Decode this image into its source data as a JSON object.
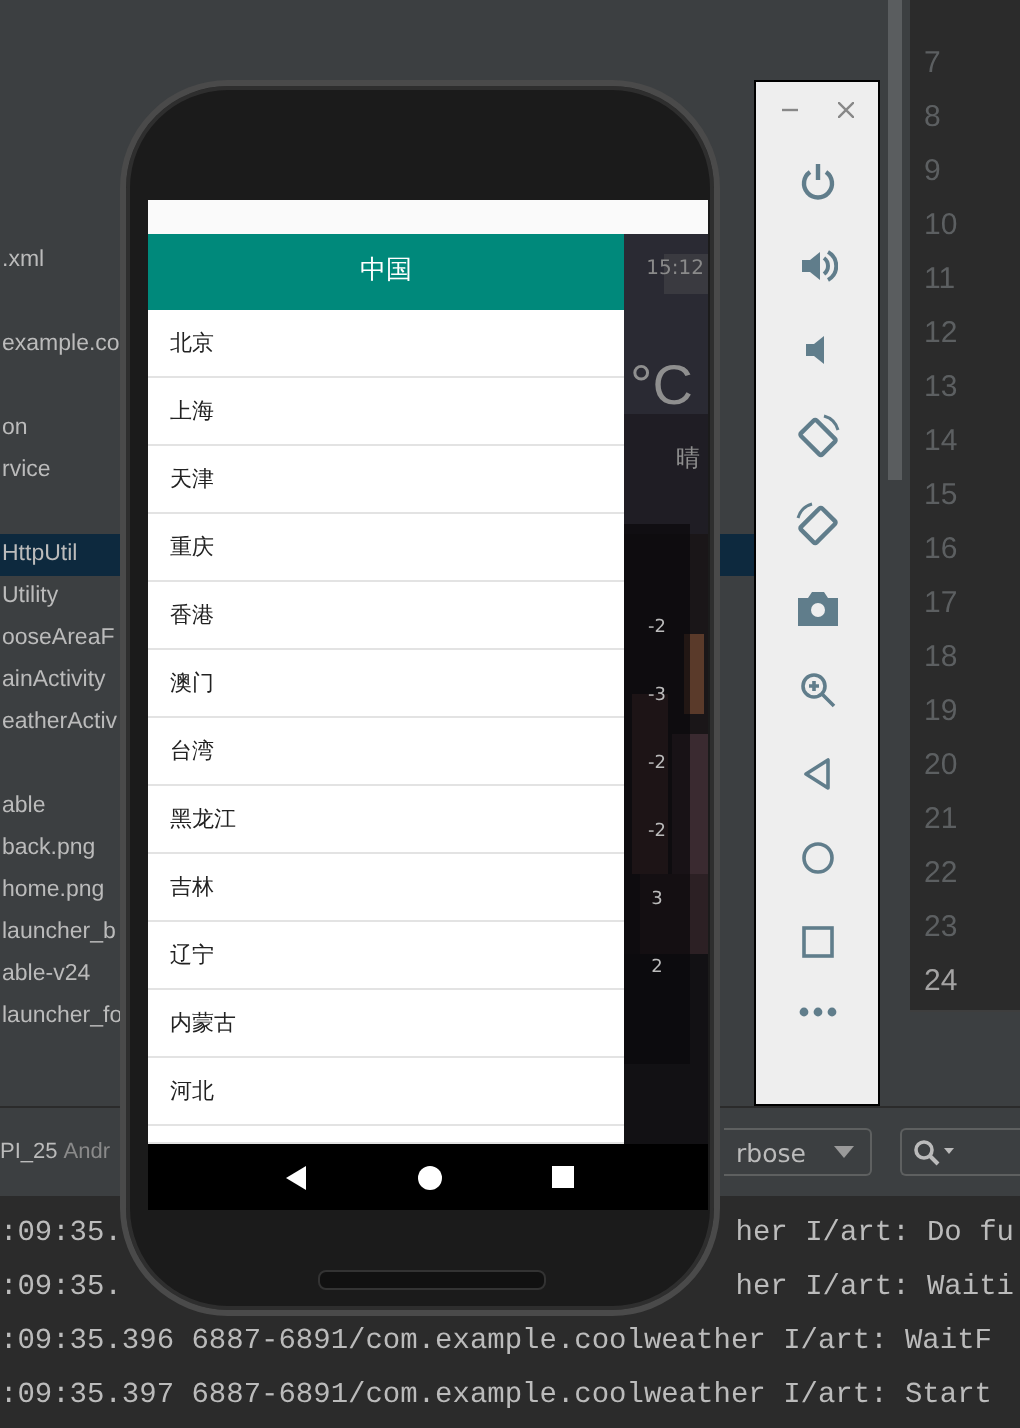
{
  "project_tree": [
    {
      "items": [
        {
          "label": ".xml",
          "selected": false
        }
      ]
    },
    {
      "items": [
        {
          "label": "example.co",
          "selected": false
        }
      ]
    },
    {
      "items": [
        {
          "label": "on",
          "selected": false
        },
        {
          "label": "rvice",
          "selected": false
        }
      ]
    },
    {
      "items": [
        {
          "label": "HttpUtil",
          "selected": true
        },
        {
          "label": "Utility",
          "selected": false
        },
        {
          "label": "ooseAreaF",
          "selected": false
        },
        {
          "label": "ainActivity",
          "selected": false
        },
        {
          "label": "eatherActiv",
          "selected": false
        }
      ]
    },
    {
      "items": [
        {
          "label": "able",
          "selected": false
        },
        {
          "label": "back.png",
          "selected": false
        },
        {
          "label": "home.png",
          "selected": false
        },
        {
          "label": "launcher_b",
          "selected": false
        },
        {
          "label": "able-v24",
          "selected": false
        },
        {
          "label": "launcher_fo",
          "selected": false
        }
      ]
    }
  ],
  "line_numbers": [
    {
      "number": "7",
      "current": false
    },
    {
      "number": "8",
      "current": false
    },
    {
      "number": "9",
      "current": false
    },
    {
      "number": "10",
      "current": false
    },
    {
      "number": "11",
      "current": false
    },
    {
      "number": "12",
      "current": false
    },
    {
      "number": "13",
      "current": false
    },
    {
      "number": "14",
      "current": false
    },
    {
      "number": "15",
      "current": false
    },
    {
      "number": "16",
      "current": false
    },
    {
      "number": "17",
      "current": false
    },
    {
      "number": "18",
      "current": false
    },
    {
      "number": "19",
      "current": false
    },
    {
      "number": "20",
      "current": false
    },
    {
      "number": "21",
      "current": false
    },
    {
      "number": "22",
      "current": false
    },
    {
      "number": "23",
      "current": false
    },
    {
      "number": "24",
      "current": true
    }
  ],
  "logcat": {
    "device": "PI_25",
    "device_detail": "Andr",
    "log_level": "rbose",
    "lines": [
      {
        "segments": [
          ":09:35.",
          "her I/art: Do fu"
        ]
      },
      {
        "segments": [
          ":09:35.",
          "her I/art: Waiti"
        ]
      },
      {
        "segments": [
          ":09:35.396 6887-6891/com.example.coolweather I/art: WaitF"
        ]
      },
      {
        "segments": [
          ":09:35.397 6887-6891/com.example.coolweather I/art: Start"
        ]
      }
    ]
  },
  "phone": {
    "drawer": {
      "title": "中国",
      "items": [
        "北京",
        "上海",
        "天津",
        "重庆",
        "香港",
        "澳门",
        "台湾",
        "黑龙江",
        "吉林",
        "辽宁",
        "内蒙古",
        "河北"
      ]
    },
    "weather": {
      "time": "15:12",
      "temperature": "°C",
      "condition": "晴",
      "forecast": [
        "-2",
        "-3",
        "-2",
        "-2",
        "3",
        "2"
      ]
    }
  },
  "emulator_toolbar": {
    "tools": [
      {
        "kind": "power"
      },
      {
        "kind": "volume_up"
      },
      {
        "kind": "volume_down"
      },
      {
        "kind": "rotate_left"
      },
      {
        "kind": "rotate_right"
      },
      {
        "kind": "camera"
      },
      {
        "kind": "zoom"
      },
      {
        "kind": "back"
      },
      {
        "kind": "home"
      },
      {
        "kind": "overview"
      },
      {
        "kind": "more"
      }
    ]
  }
}
